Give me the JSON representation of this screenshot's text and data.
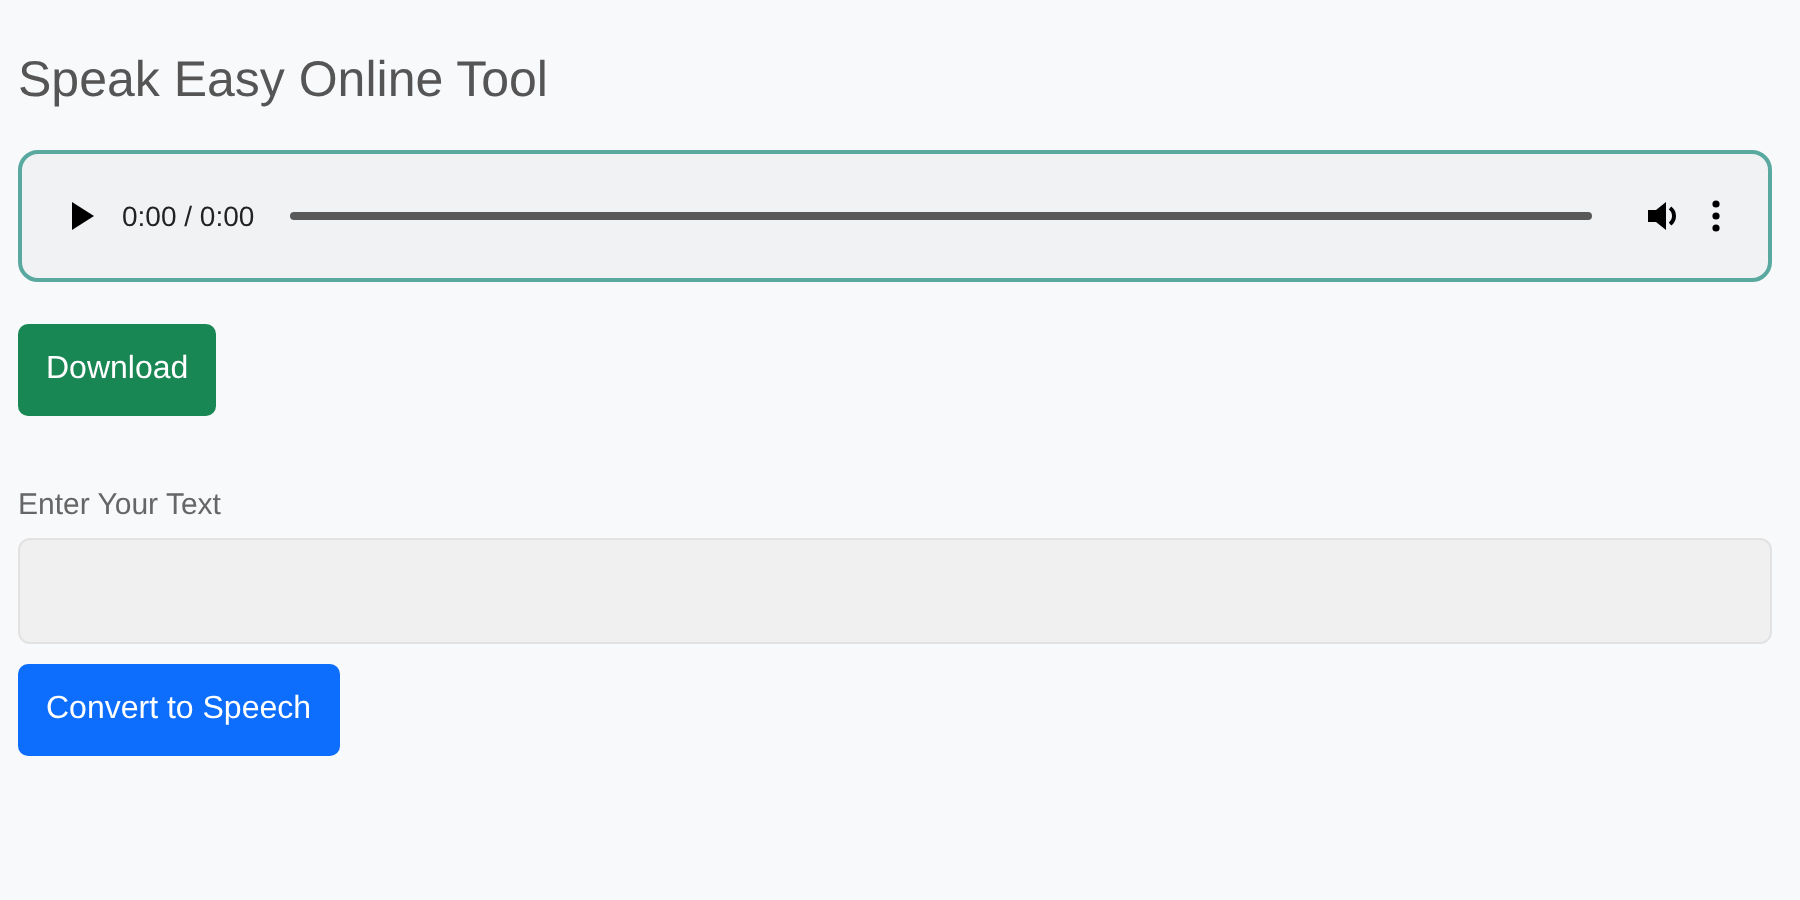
{
  "title": "Speak Easy Online Tool",
  "audio_player": {
    "time": "0:00 / 0:00"
  },
  "download_button": "Download",
  "text_input": {
    "label": "Enter Your Text"
  },
  "convert_button": "Convert to Speech"
}
